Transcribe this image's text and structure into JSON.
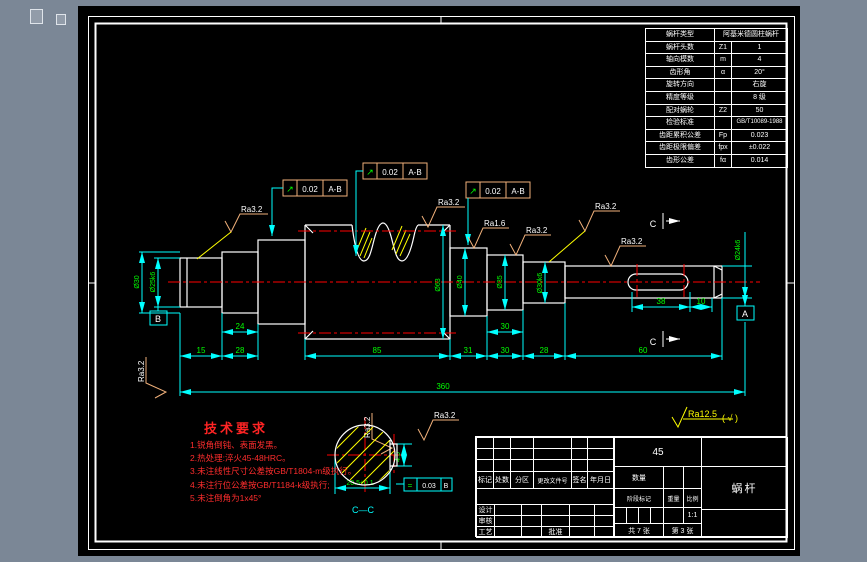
{
  "app": {
    "background": "#7b8796",
    "canvas_color": "#000000"
  },
  "worm_table": {
    "rows": [
      [
        "蜗杆类型",
        "",
        "阿基米德圆柱蜗杆"
      ],
      [
        "蜗杆头数",
        "Z1",
        "1"
      ],
      [
        "轴向模数",
        "m",
        "4"
      ],
      [
        "齿形角",
        "α",
        "20°"
      ],
      [
        "旋转方向",
        "",
        "右旋"
      ],
      [
        "精度等级",
        "",
        "8 级"
      ],
      [
        "配对蜗轮",
        "Z2",
        "50"
      ],
      [
        "检验标准",
        "",
        "GB/T10089-1988"
      ],
      [
        "齿距累积公差",
        "Fp",
        "0.023"
      ],
      [
        "齿距极限偏差",
        "fpx",
        "±0.022"
      ],
      [
        "齿形公差",
        "fα",
        "0.014"
      ]
    ]
  },
  "tech_requirements": {
    "title": "技术要求",
    "lines": [
      "1.锐角倒钝、表面发黑。",
      "2.热处理:淬火45-48HRC。",
      "3.未注线性尺寸公差按GB/T1804-m级执行。",
      "4.未注行位公差按GB/T1184-k级执行;",
      "5.未注倒角为1x45°"
    ]
  },
  "title_block": {
    "material": "45",
    "part_name": "蜗杆",
    "quantity_label": "数量",
    "stage_label": "阶段标记",
    "weight_label": "重量",
    "scale_label": "比例",
    "scale": "1:1",
    "sheets_total": "共 7 张",
    "sheet_no": "第 3 张",
    "header": [
      "标记",
      "处数",
      "分区",
      "更改文件号",
      "签名",
      "年月日"
    ],
    "roles": [
      "设计",
      "审核",
      "工艺"
    ],
    "approve": "批准"
  },
  "drawing": {
    "colors": {
      "dimension": "#00ffff",
      "dim_text": "#00ff00",
      "centerline": "#ff0000",
      "outline": "#ffffff",
      "symbol_frame": "#f0b07a",
      "hatch": "#ffff00"
    },
    "dims": {
      "chain": [
        "15",
        "28",
        "85",
        "31",
        "30",
        "28",
        "60"
      ],
      "mid": [
        "24",
        "30"
      ],
      "keyway": [
        "38",
        "10"
      ],
      "overall": "360",
      "diameters": [
        "Ø30",
        "Ø25k6",
        "Ø63",
        "Ø40",
        "Ø35",
        "Ø30k6",
        "Ø24k6"
      ],
      "section_width": "20.5±0.1",
      "section_depth": "4.5"
    },
    "gdt": {
      "symbol": "↗",
      "value": "0.02",
      "datum": "A-B"
    },
    "sym_frame": {
      "symbol": "=",
      "value": "0.03",
      "datum": "B"
    },
    "roughness": {
      "ra32": "Ra3.2",
      "ra16": "Ra1.6",
      "general": "Ra12.5",
      "general_suffix": "( √ )"
    },
    "datums": {
      "a": "A",
      "b": "B"
    },
    "section": {
      "letter": "C",
      "label": "C—C"
    }
  }
}
